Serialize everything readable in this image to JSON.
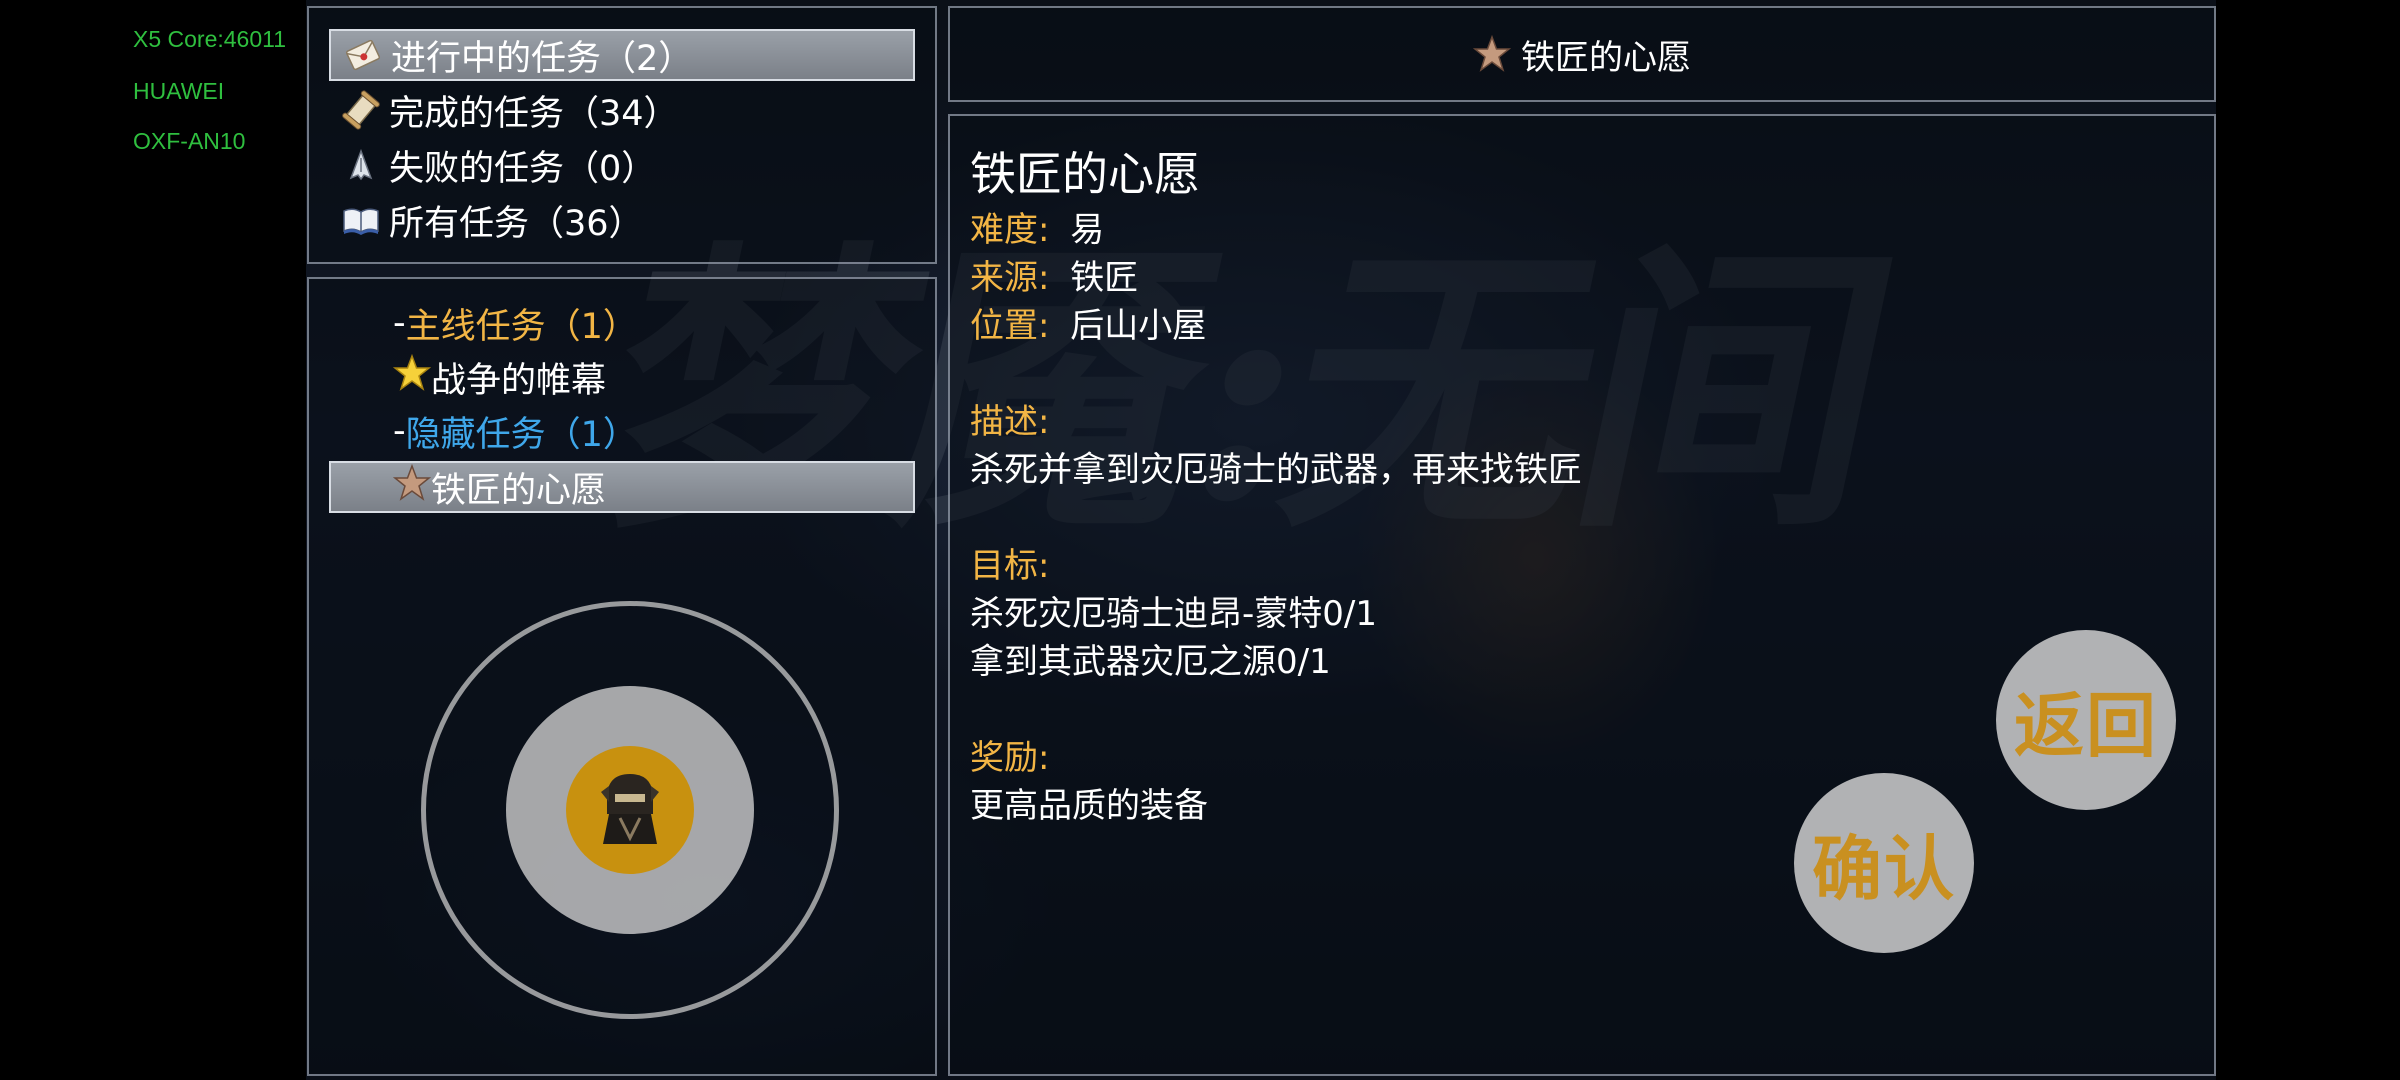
{
  "device_info": [
    "X5 Core:46011",
    "HUAWEI",
    "OXF-AN10"
  ],
  "watermark_text": "梦魇:无间",
  "categories": [
    {
      "label": "进行中的任务（2）",
      "icon": "scroll-letter-icon",
      "selected": true
    },
    {
      "label": "完成的任务（34）",
      "icon": "rolled-scroll-icon",
      "selected": false
    },
    {
      "label": "失败的任务（0）",
      "icon": "broken-blade-icon",
      "selected": false
    },
    {
      "label": "所有任务（36）",
      "icon": "open-book-icon",
      "selected": false
    }
  ],
  "quest_tree": {
    "main_group": "主线任务（1）",
    "main_quest": "战争的帷幕",
    "hidden_group": "隐藏任务（1）",
    "hidden_quest": "铁匠的心愿",
    "dash": "-"
  },
  "header_title": "铁匠的心愿",
  "detail": {
    "title": "铁匠的心愿",
    "difficulty_label": "难度:",
    "difficulty": "易",
    "source_label": "来源:",
    "source": "铁匠",
    "location_label": "位置:",
    "location": "后山小屋",
    "description_label": "描述:",
    "description": "杀死并拿到灾厄骑士的武器，再来找铁匠",
    "objectives_label": "目标:",
    "objectives": [
      "杀死灾厄骑士迪昂-蒙特0/1",
      "拿到其武器灾厄之源0/1"
    ],
    "reward_label": "奖励:",
    "reward": "更高品质的装备"
  },
  "buttons": {
    "back": "返回",
    "confirm": "确认"
  },
  "colors": {
    "main_group": "#f2b545",
    "hidden_group": "#3fa7ea",
    "label": "#f2b545",
    "device_info": "#2fbf3f",
    "button_text": "#c99020"
  },
  "joystick": {
    "thumb_icon": "helmet-icon"
  }
}
